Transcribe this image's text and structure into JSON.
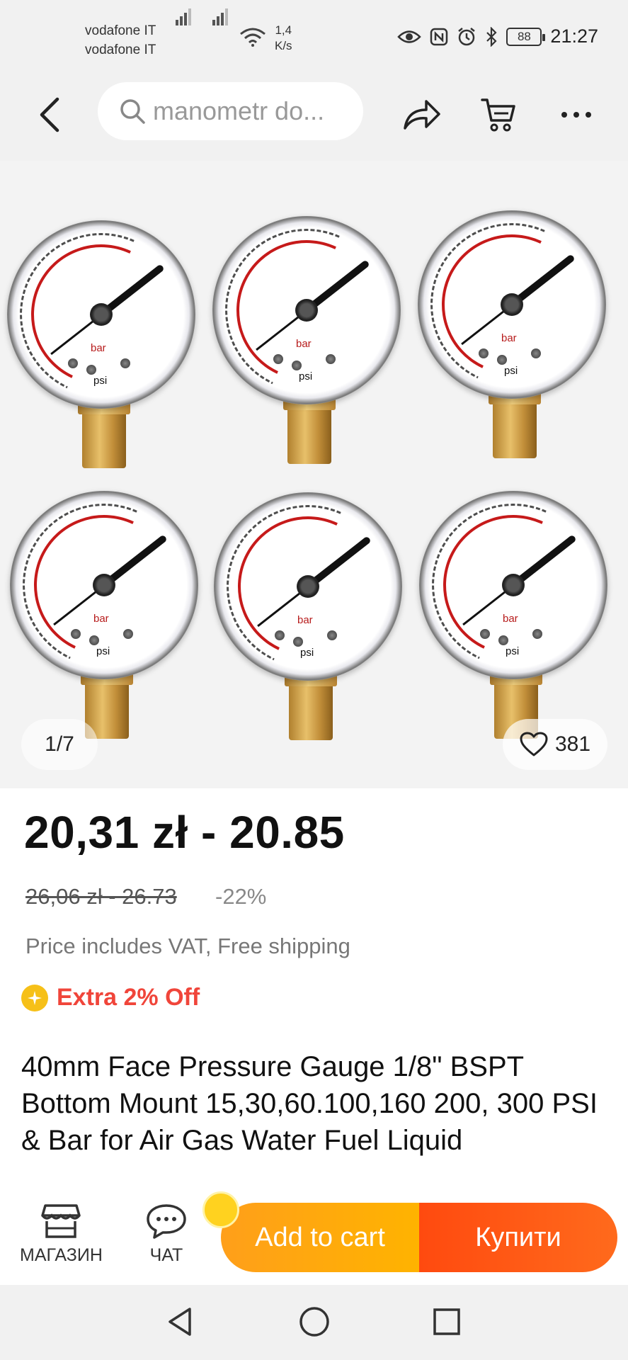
{
  "status_bar": {
    "carrier_1": "vodafone IT",
    "carrier_2": "vodafone IT",
    "net_speed_value": "1,4",
    "net_speed_unit": "K/s",
    "battery": "88",
    "time": "21:27"
  },
  "header": {
    "search_text": "manometr do..."
  },
  "gallery": {
    "counter": "1/7",
    "wishlist_count": "381",
    "gauge_labels": {
      "bar": "bar",
      "psi": "psi"
    }
  },
  "product": {
    "price": "20,31 zł - 20.85",
    "old_price": "26,06 zł - 26.73",
    "discount": "-22%",
    "vat_note": "Price includes VAT, Free shipping",
    "extra_off": "Extra 2% Off",
    "title": "40mm Face Pressure Gauge 1/8\" BSPT Bottom Mount 15,30,60.100,160 200, 300 PSI & Bar for Air Gas Water Fuel Liquid"
  },
  "action_bar": {
    "store_label": "МАГАЗИН",
    "chat_label": "ЧАТ",
    "add_to_cart": "Add to cart",
    "buy_now": "Купити"
  },
  "colors": {
    "accent_orange": "#ffa31a",
    "accent_red": "#ff4a0f",
    "promo_red": "#f0453a",
    "coin_yellow": "#f6c018"
  }
}
